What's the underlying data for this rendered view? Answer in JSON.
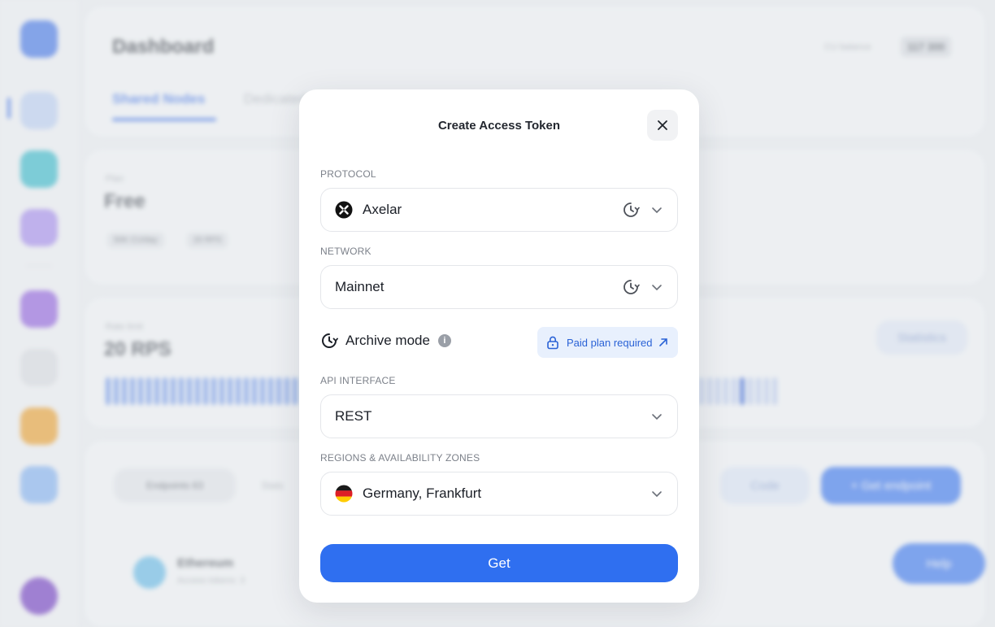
{
  "background": {
    "title": "Dashboard",
    "tabs": [
      "Shared Nodes",
      "Dedicated"
    ],
    "balance_label": "CU balance",
    "balance_value": "117 300",
    "plan_label": "Plan",
    "plan_value": "Free",
    "plan_chips": [
      "50K CU/day",
      "20 RPS"
    ],
    "rate_label": "Rate limit",
    "rate_value": "20 RPS",
    "statistics_button": "Statistics",
    "endpoints_tab": "Endpoints 63",
    "stats_tab": "Stats",
    "code_button": "Code",
    "get_endpoint_button": "+ Get endpoint",
    "help_button": "Help",
    "row_name": "Ethereum",
    "row_sub": "Access tokens: 3"
  },
  "modal": {
    "title": "Create Access Token",
    "protocol": {
      "label": "PROTOCOL",
      "value": "Axelar"
    },
    "network": {
      "label": "NETWORK",
      "value": "Mainnet"
    },
    "archive": {
      "label": "Archive mode",
      "info": "i",
      "paid_label": "Paid plan required"
    },
    "api_interface": {
      "label": "API INTERFACE",
      "value": "REST"
    },
    "regions": {
      "label": "REGIONS & AVAILABILITY ZONES",
      "value": "Germany, Frankfurt"
    },
    "submit_label": "Get"
  },
  "colors": {
    "accent": "#2f6ff0",
    "paid_bg": "#e8f0fd",
    "paid_text": "#2a62d6"
  }
}
